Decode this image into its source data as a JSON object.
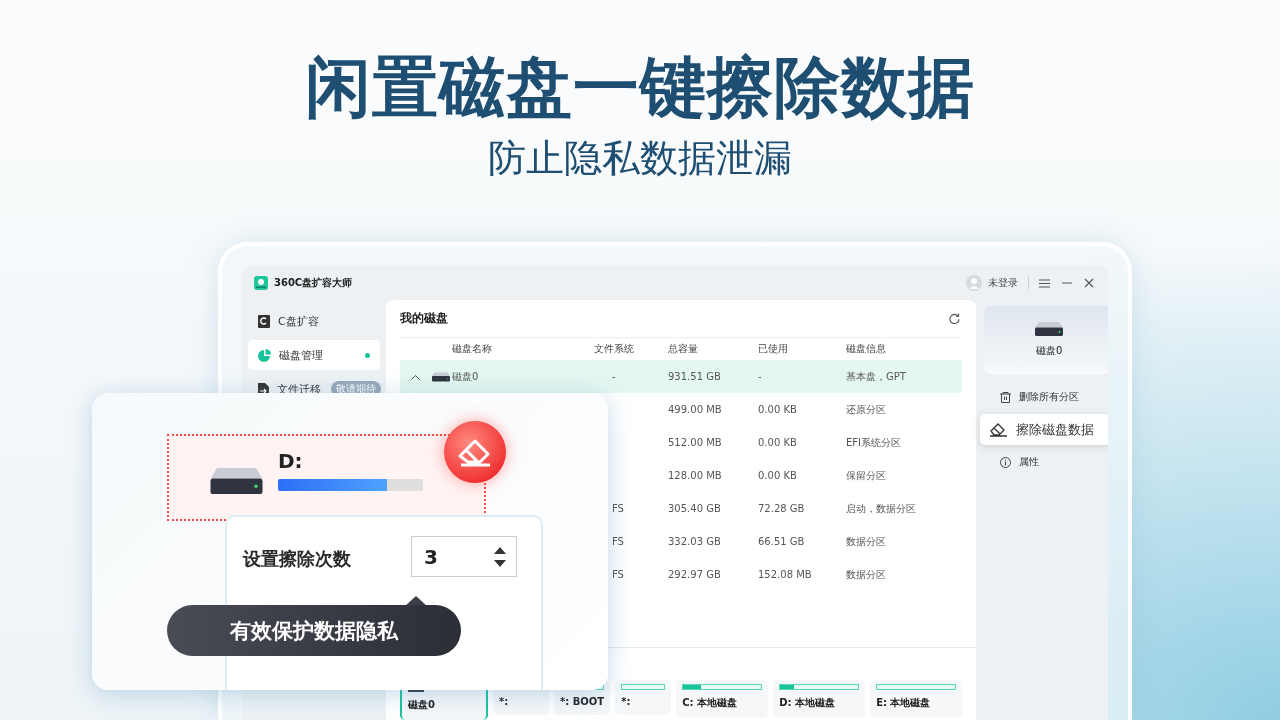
{
  "headline": "闲置磁盘一键擦除数据",
  "subheadline": "防止隐私数据泄漏",
  "app": {
    "title": "360C盘扩容大师",
    "user": "未登录",
    "sidebar": [
      {
        "kind": "expand",
        "label": "C盘扩容",
        "selected": false
      },
      {
        "kind": "manage",
        "label": "磁盘管理",
        "selected": true
      },
      {
        "kind": "migrate",
        "label": "文件迁移",
        "selected": false,
        "badge": "敬请期待"
      }
    ],
    "panel_title": "我的磁盘",
    "table": {
      "columns": [
        "磁盘名称",
        "文件系统",
        "总容量",
        "已使用",
        "磁盘信息"
      ],
      "rows": [
        {
          "expanded": true,
          "name": "磁盘0",
          "fs": "-",
          "total": "931.51  GB",
          "used": "-",
          "info": "基本盘，GPT",
          "selected": true
        },
        {
          "total": "499.00  MB",
          "used": "0.00 KB",
          "info": "还原分区",
          "selected": false
        },
        {
          "total": "512.00  MB",
          "used": "0.00 KB",
          "info": "EFI系统分区",
          "selected": false
        },
        {
          "total": "128.00  MB",
          "used": "0.00 KB",
          "info": "保留分区",
          "selected": false
        },
        {
          "fs": "FS",
          "total": "305.40  GB",
          "used": "72.28  GB",
          "info": "启动，数据分区",
          "selected": false
        },
        {
          "fs": "FS",
          "total": "332.03  GB",
          "used": "66.51  GB",
          "info": "数据分区",
          "selected": false
        },
        {
          "fs": "FS",
          "total": "292.97  GB",
          "used": "152.08  MB",
          "info": "数据分区",
          "selected": false
        }
      ]
    },
    "partitions": [
      {
        "kind": "disk",
        "label": "磁盘0",
        "selected": true
      },
      {
        "kind": "partition",
        "label": "*:",
        "level": 0,
        "selected": false
      },
      {
        "kind": "partition",
        "label": "*: BOOT",
        "level": 0,
        "selected": false
      },
      {
        "kind": "partition",
        "label": "*:",
        "level": 0,
        "selected": false
      },
      {
        "kind": "partition",
        "label": "C: 本地磁盘",
        "level": 0.23,
        "selected": false
      },
      {
        "kind": "partition",
        "label": "D: 本地磁盘",
        "level": 0.18,
        "selected": false
      },
      {
        "kind": "partition",
        "label": "E: 本地磁盘",
        "level": 0,
        "selected": false
      }
    ],
    "side_panel": {
      "disk": "磁盘0",
      "actions": [
        {
          "kind": "delete",
          "label": "删除所有分区",
          "selected": false
        },
        {
          "kind": "erase",
          "label": "擦除磁盘数据",
          "selected": true
        },
        {
          "kind": "info",
          "label": "属性",
          "selected": false
        }
      ]
    }
  },
  "erase_card": {
    "drive": "D:",
    "level": 0.75,
    "count_label": "设置擦除次数",
    "count": "3",
    "tooltip": "有效保护数据隐私"
  }
}
